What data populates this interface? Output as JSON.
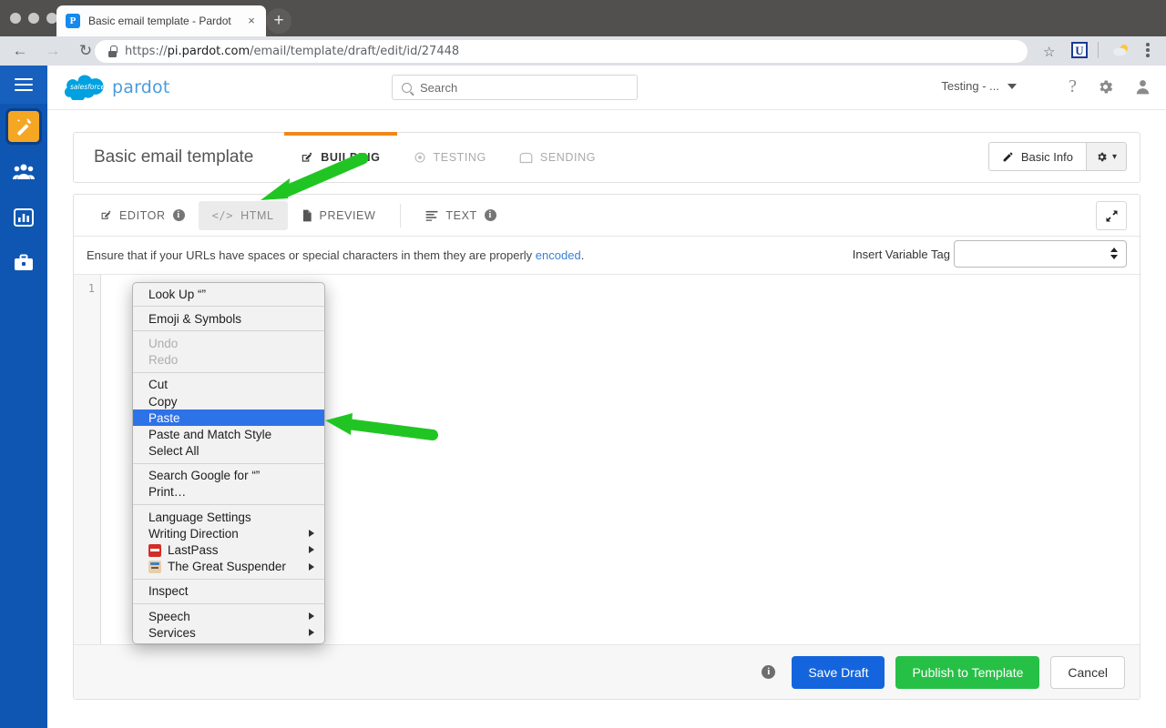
{
  "browser": {
    "tab": {
      "title": "Basic email template - Pardot",
      "favicon_letter": "P",
      "close_label": "×"
    },
    "new_tab_label": "+",
    "nav": {
      "back": "←",
      "forward": "→",
      "reload": "↻"
    },
    "url_scheme": "https://",
    "url_host": "pi.pardot.com",
    "url_path": "/email/template/draft/edit/id/27448",
    "star_label": "☆",
    "extension_u_label": "U"
  },
  "sidebar": {
    "items": [
      {
        "name": "menu",
        "icon": "hamburger-icon"
      },
      {
        "name": "marketing",
        "icon": "magic-wand-icon",
        "active": true
      },
      {
        "name": "prospects",
        "icon": "people-icon"
      },
      {
        "name": "reports",
        "icon": "bar-chart-icon"
      },
      {
        "name": "admin",
        "icon": "briefcase-icon"
      }
    ]
  },
  "header": {
    "logo_word": "pardot",
    "logo_mark_text": "salesforce",
    "search": {
      "placeholder": "Search",
      "value": ""
    },
    "account": "Testing - ...",
    "icons": [
      "help-icon",
      "gear-icon",
      "user-icon"
    ]
  },
  "page": {
    "title": "Basic email template",
    "steps": [
      {
        "label": "BUILDING",
        "icon": "pencil-square-icon",
        "active": true
      },
      {
        "label": "TESTING",
        "icon": "target-icon",
        "active": false
      },
      {
        "label": "SENDING",
        "icon": "envelope-icon",
        "active": false
      }
    ],
    "basic_info_label": "Basic Info",
    "gear_caret": "▾"
  },
  "editor": {
    "tabs": [
      {
        "label": "EDITOR",
        "icon": "pencil-square-icon",
        "info": true,
        "selected": false
      },
      {
        "label": "HTML",
        "icon": "code-icon",
        "info": false,
        "selected": true
      },
      {
        "label": "PREVIEW",
        "icon": "document-icon",
        "info": false,
        "selected": false
      },
      {
        "label": "TEXT",
        "icon": "text-lines-icon",
        "info": true,
        "selected": false
      }
    ],
    "expand_title": "expand-icon",
    "notice_before": "Ensure that if your URLs have spaces or special characters in them they are properly ",
    "notice_link": "encoded",
    "notice_after": ".",
    "insert_variable_label": "Insert Variable Tag",
    "insert_variable_value": "",
    "line_numbers": [
      "1"
    ],
    "code_value": ""
  },
  "footer": {
    "info_icon": "info-icon",
    "save_draft": "Save Draft",
    "publish": "Publish to Template",
    "cancel": "Cancel"
  },
  "context_menu": {
    "groups": [
      {
        "items": [
          {
            "label": "Look Up “”"
          }
        ]
      },
      {
        "items": [
          {
            "label": "Emoji & Symbols"
          }
        ]
      },
      {
        "items": [
          {
            "label": "Undo",
            "disabled": true
          },
          {
            "label": "Redo",
            "disabled": true
          }
        ]
      },
      {
        "items": [
          {
            "label": "Cut"
          },
          {
            "label": "Copy"
          },
          {
            "label": "Paste",
            "highlighted": true
          },
          {
            "label": "Paste and Match Style"
          },
          {
            "label": "Select All"
          }
        ]
      },
      {
        "items": [
          {
            "label": "Search Google for “”"
          },
          {
            "label": "Print…"
          }
        ]
      },
      {
        "items": [
          {
            "label": "Language Settings"
          },
          {
            "label": "Writing Direction",
            "submenu": true
          },
          {
            "label": "LastPass",
            "submenu": true,
            "icon": "lastpass-icon"
          },
          {
            "label": "The Great Suspender",
            "submenu": true,
            "icon": "great-suspender-icon"
          }
        ]
      },
      {
        "items": [
          {
            "label": "Inspect"
          }
        ]
      },
      {
        "items": [
          {
            "label": "Speech",
            "submenu": true
          },
          {
            "label": "Services",
            "submenu": true
          }
        ]
      }
    ]
  },
  "annotations": {
    "arrow_color": "#21c523",
    "arrows": [
      {
        "name": "arrow-to-html-tab",
        "target": "HTML tab"
      },
      {
        "name": "arrow-to-paste-item",
        "target": "Paste menu item"
      }
    ]
  },
  "colors": {
    "brand_blue": "#0f56b3",
    "accent_orange": "#f0861a",
    "primary_button": "#1465dd",
    "success_button": "#27c046",
    "highlight_blue": "#2e72e8"
  }
}
